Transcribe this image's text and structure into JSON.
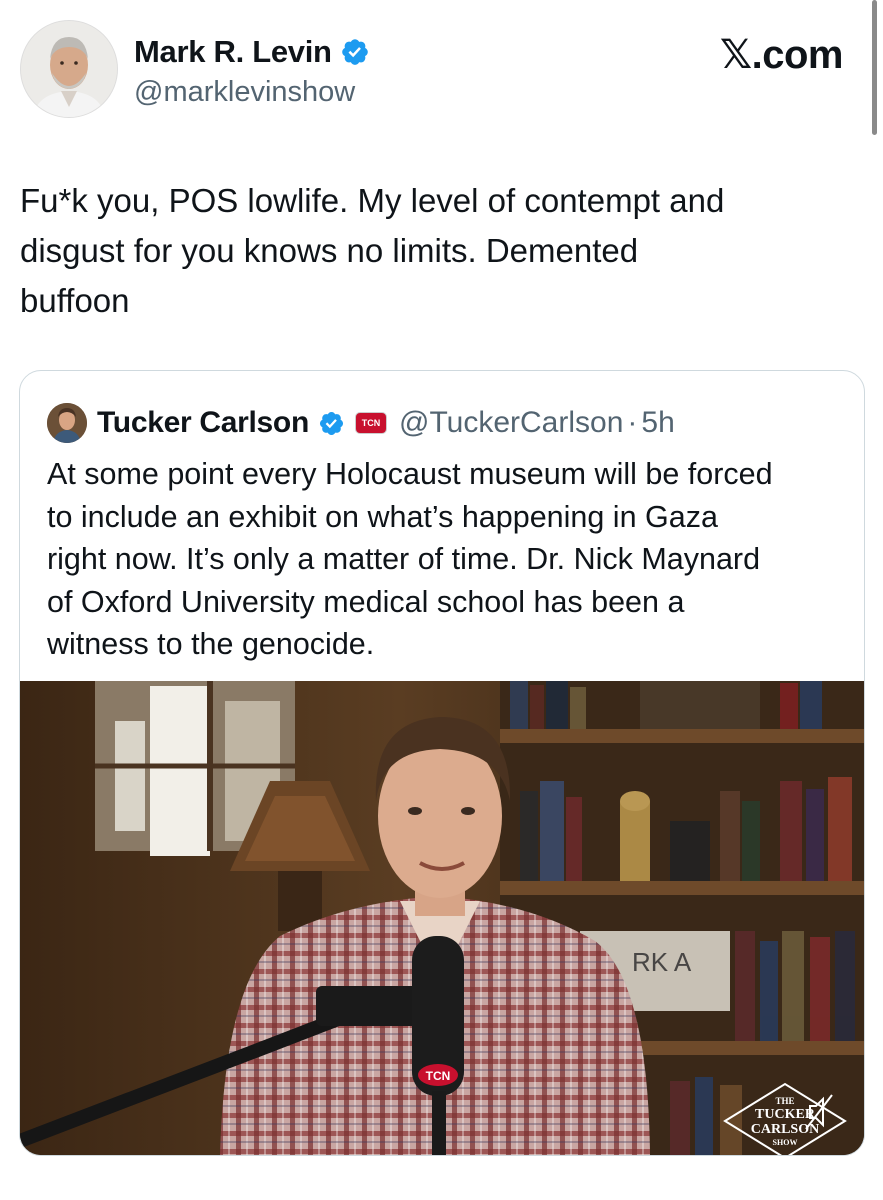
{
  "post": {
    "author": {
      "display_name": "Mark R. Levin",
      "handle": "@marklevinshow",
      "verified": true
    },
    "brand": "𝕏.com",
    "text": "Fu*k you, POS lowlife. My level of contempt and\ndisgust for you knows no limits.  Demented\nbuffoon"
  },
  "quoted_post": {
    "author": {
      "display_name": "Tucker Carlson",
      "handle": "@TuckerCarlson",
      "verified": true,
      "affiliate_badge": "TCN"
    },
    "separator": "·",
    "time": "5h",
    "text": "At some point every Holocaust museum will be forced\nto include an exhibit on what’s happening in Gaza\nright now. It’s only a matter of time. Dr. Nick Maynard\nof Oxford University medical school has been a\nwitness to the genocide.",
    "media": {
      "type": "video",
      "watermark": [
        "THE",
        "TUCKER",
        "CARLSON",
        "SHOW"
      ],
      "mic_label": "TCN",
      "sign_text": "RK A"
    }
  },
  "colors": {
    "verified_blue": "#1d9bf0",
    "secondary_text": "#536471",
    "border": "#cfd9de",
    "tcn_red": "#c8102e"
  }
}
